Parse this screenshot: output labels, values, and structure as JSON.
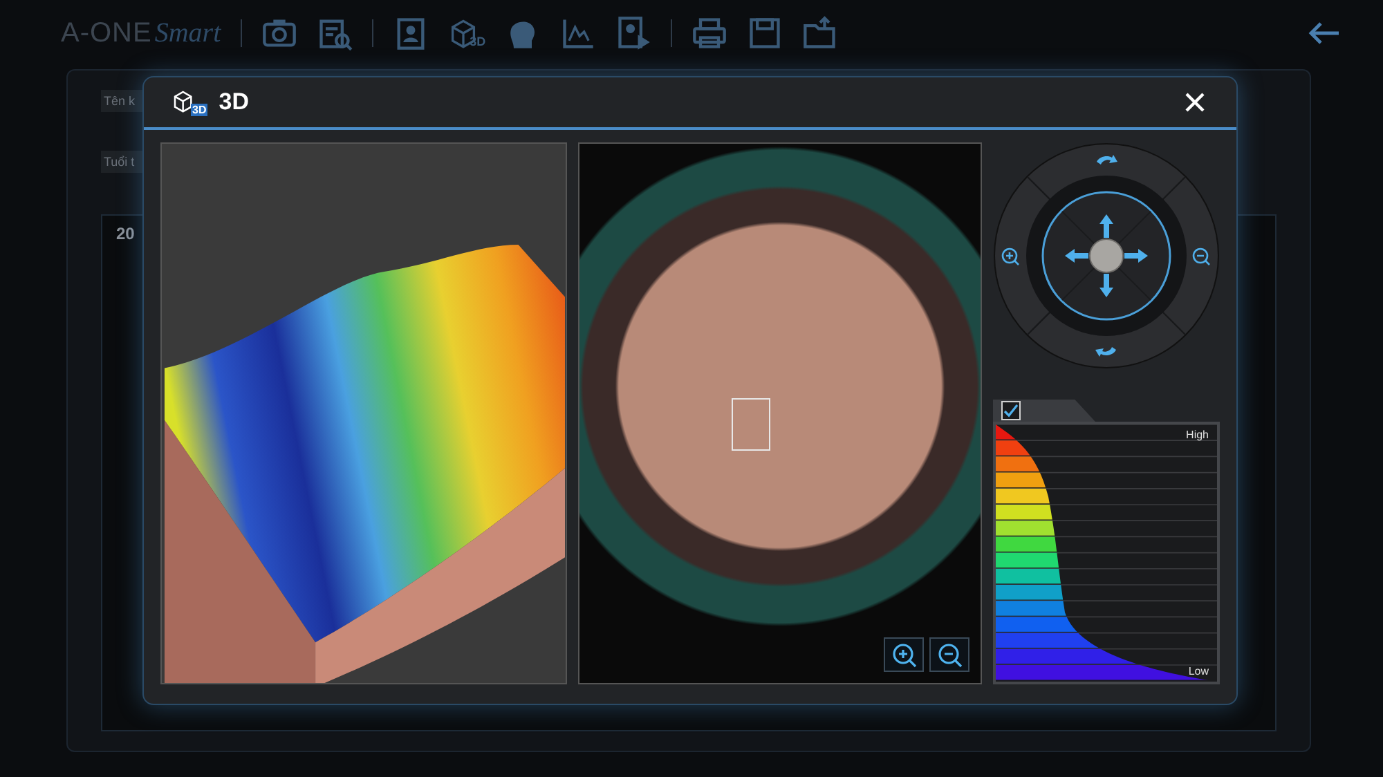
{
  "app": {
    "logo": {
      "brand": "A-ONE",
      "suffix": "Smart"
    },
    "toolbar_3d_badge": "3D"
  },
  "background_form": {
    "fields": [
      "Tên k",
      "Tuổi t"
    ],
    "card_label": "20"
  },
  "dialog": {
    "title": "3D",
    "title_icon_badge": "3D",
    "legend": {
      "checked": true,
      "high_label": "High",
      "low_label": "Low"
    }
  }
}
